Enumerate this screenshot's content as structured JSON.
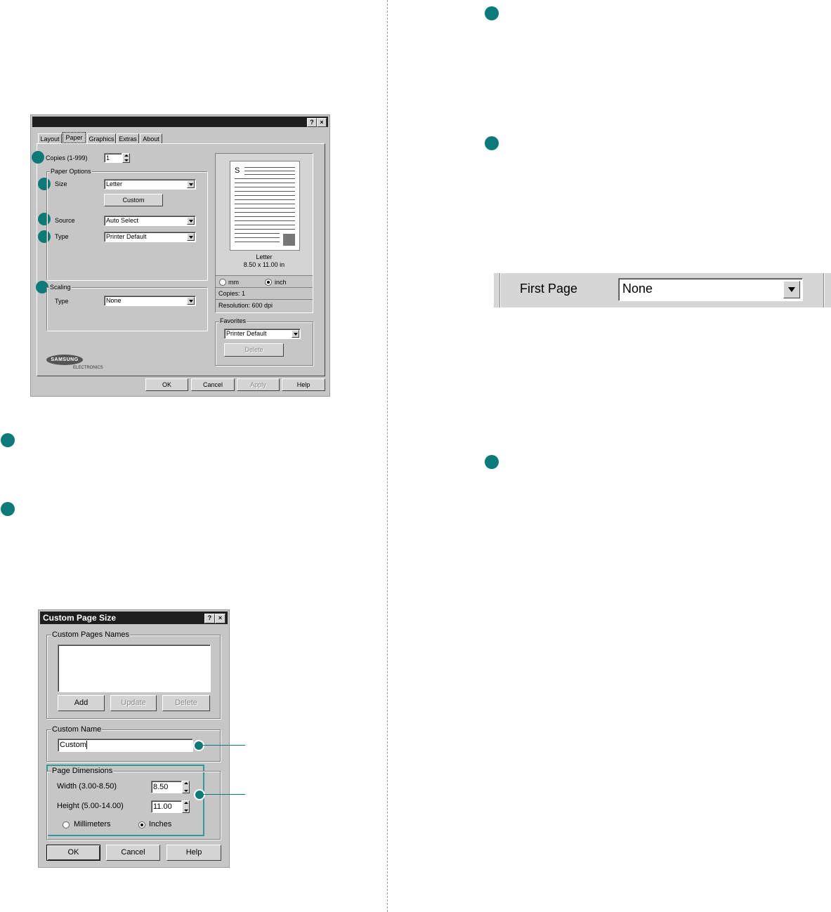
{
  "markers": {},
  "printer_dialog": {
    "help_btn": "?",
    "close_btn": "×",
    "tabs": [
      "Layout",
      "Paper",
      "Graphics",
      "Extras",
      "About"
    ],
    "copies_label": "Copies (1-999)",
    "copies_value": "1",
    "paper_options_label": "Paper Options",
    "size_label": "Size",
    "size_value": "Letter",
    "custom_button": "Custom",
    "source_label": "Source",
    "source_value": "Auto Select",
    "type_label": "Type",
    "type_value": "Printer Default",
    "scaling_label": "Scaling",
    "scaling_type_label": "Type",
    "scaling_type_value": "None",
    "preview_glyph": "S",
    "preview_paper_name": "Letter",
    "preview_paper_size": "8.50 x 11.00 in",
    "unit_mm": "mm",
    "unit_inch": "inch",
    "copies_info": "Copies: 1",
    "resolution_info": "Resolution: 600 dpi",
    "favorites_label": "Favorites",
    "favorites_value": "Printer Default",
    "delete_button": "Delete",
    "brand_main": "SAMSUNG",
    "brand_sub": "ELECTRONICS",
    "ok": "OK",
    "cancel": "Cancel",
    "apply": "Apply",
    "help": "Help"
  },
  "custom_dialog": {
    "title": "Custom Page Size",
    "help_btn": "?",
    "close_btn": "×",
    "names_group": "Custom Pages Names",
    "add": "Add",
    "update": "Update",
    "delete": "Delete",
    "name_group": "Custom Name",
    "name_value": "Custom",
    "dims_group": "Page Dimensions",
    "width_label": "Width (3.00-8.50)",
    "width_value": "8.50",
    "height_label": "Height (5.00-14.00)",
    "height_value": "11.00",
    "mm_label": "Millimeters",
    "inches_label": "Inches",
    "ok": "OK",
    "cancel": "Cancel",
    "help": "Help"
  },
  "first_page": {
    "label": "First Page",
    "value": "None"
  },
  "colors": {
    "marker": "#0d7a7a",
    "dialog_bg": "#c6c6c6",
    "titlebar": "#1e1e1e"
  }
}
